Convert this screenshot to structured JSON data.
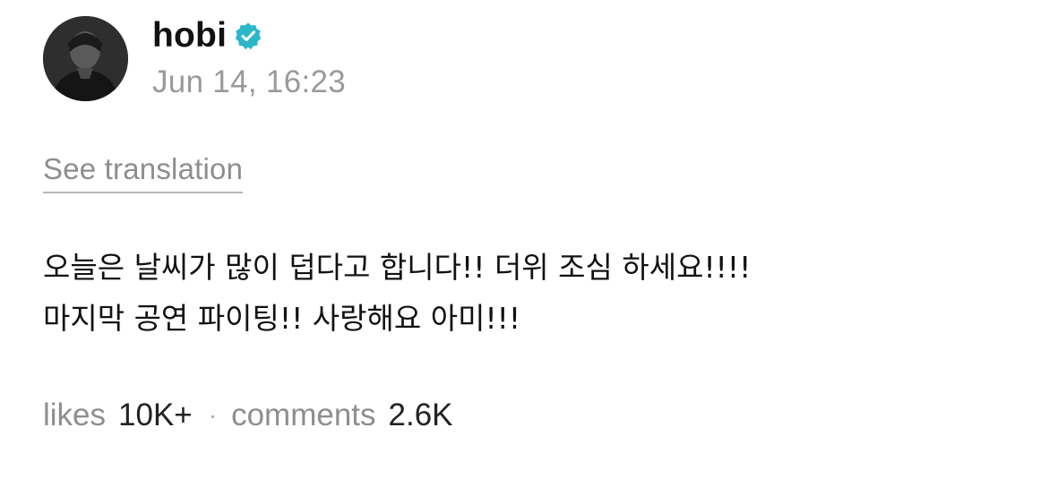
{
  "post": {
    "author": {
      "username": "hobi",
      "verified_icon": "verified-badge-icon",
      "avatar": "profile-photo"
    },
    "timestamp": "Jun 14, 16:23",
    "translate_label": "See translation",
    "body_lines": [
      "오늘은 날씨가 많이 덥다고 합니다!! 더위 조심 하세요!!!!",
      "마지막 공연 파이팅!! 사랑해요 아미!!!"
    ],
    "stats": {
      "likes_label": "likes",
      "likes_value": "10K+",
      "separator": "·",
      "comments_label": "comments",
      "comments_value": "2.6K"
    }
  },
  "colors": {
    "verified": "#2bb7c9",
    "text": "#111111",
    "muted": "#8e8e8e"
  }
}
